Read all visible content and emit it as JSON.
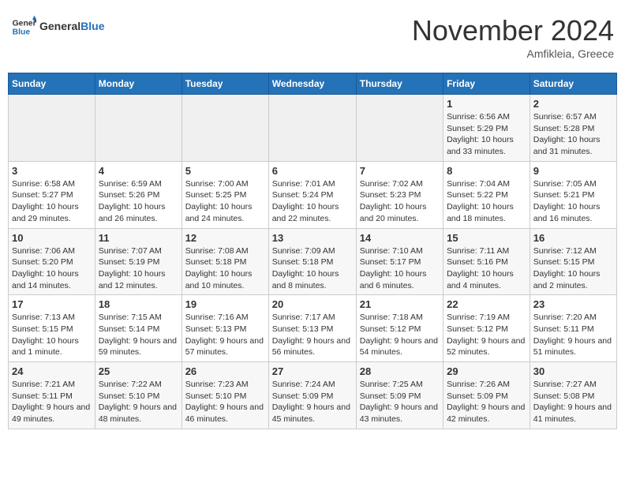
{
  "header": {
    "logo_general": "General",
    "logo_blue": "Blue",
    "month_title": "November 2024",
    "location": "Amfikleia, Greece"
  },
  "weekdays": [
    "Sunday",
    "Monday",
    "Tuesday",
    "Wednesday",
    "Thursday",
    "Friday",
    "Saturday"
  ],
  "weeks": [
    [
      {
        "day": "",
        "info": ""
      },
      {
        "day": "",
        "info": ""
      },
      {
        "day": "",
        "info": ""
      },
      {
        "day": "",
        "info": ""
      },
      {
        "day": "",
        "info": ""
      },
      {
        "day": "1",
        "info": "Sunrise: 6:56 AM\nSunset: 5:29 PM\nDaylight: 10 hours and 33 minutes."
      },
      {
        "day": "2",
        "info": "Sunrise: 6:57 AM\nSunset: 5:28 PM\nDaylight: 10 hours and 31 minutes."
      }
    ],
    [
      {
        "day": "3",
        "info": "Sunrise: 6:58 AM\nSunset: 5:27 PM\nDaylight: 10 hours and 29 minutes."
      },
      {
        "day": "4",
        "info": "Sunrise: 6:59 AM\nSunset: 5:26 PM\nDaylight: 10 hours and 26 minutes."
      },
      {
        "day": "5",
        "info": "Sunrise: 7:00 AM\nSunset: 5:25 PM\nDaylight: 10 hours and 24 minutes."
      },
      {
        "day": "6",
        "info": "Sunrise: 7:01 AM\nSunset: 5:24 PM\nDaylight: 10 hours and 22 minutes."
      },
      {
        "day": "7",
        "info": "Sunrise: 7:02 AM\nSunset: 5:23 PM\nDaylight: 10 hours and 20 minutes."
      },
      {
        "day": "8",
        "info": "Sunrise: 7:04 AM\nSunset: 5:22 PM\nDaylight: 10 hours and 18 minutes."
      },
      {
        "day": "9",
        "info": "Sunrise: 7:05 AM\nSunset: 5:21 PM\nDaylight: 10 hours and 16 minutes."
      }
    ],
    [
      {
        "day": "10",
        "info": "Sunrise: 7:06 AM\nSunset: 5:20 PM\nDaylight: 10 hours and 14 minutes."
      },
      {
        "day": "11",
        "info": "Sunrise: 7:07 AM\nSunset: 5:19 PM\nDaylight: 10 hours and 12 minutes."
      },
      {
        "day": "12",
        "info": "Sunrise: 7:08 AM\nSunset: 5:18 PM\nDaylight: 10 hours and 10 minutes."
      },
      {
        "day": "13",
        "info": "Sunrise: 7:09 AM\nSunset: 5:18 PM\nDaylight: 10 hours and 8 minutes."
      },
      {
        "day": "14",
        "info": "Sunrise: 7:10 AM\nSunset: 5:17 PM\nDaylight: 10 hours and 6 minutes."
      },
      {
        "day": "15",
        "info": "Sunrise: 7:11 AM\nSunset: 5:16 PM\nDaylight: 10 hours and 4 minutes."
      },
      {
        "day": "16",
        "info": "Sunrise: 7:12 AM\nSunset: 5:15 PM\nDaylight: 10 hours and 2 minutes."
      }
    ],
    [
      {
        "day": "17",
        "info": "Sunrise: 7:13 AM\nSunset: 5:15 PM\nDaylight: 10 hours and 1 minute."
      },
      {
        "day": "18",
        "info": "Sunrise: 7:15 AM\nSunset: 5:14 PM\nDaylight: 9 hours and 59 minutes."
      },
      {
        "day": "19",
        "info": "Sunrise: 7:16 AM\nSunset: 5:13 PM\nDaylight: 9 hours and 57 minutes."
      },
      {
        "day": "20",
        "info": "Sunrise: 7:17 AM\nSunset: 5:13 PM\nDaylight: 9 hours and 56 minutes."
      },
      {
        "day": "21",
        "info": "Sunrise: 7:18 AM\nSunset: 5:12 PM\nDaylight: 9 hours and 54 minutes."
      },
      {
        "day": "22",
        "info": "Sunrise: 7:19 AM\nSunset: 5:12 PM\nDaylight: 9 hours and 52 minutes."
      },
      {
        "day": "23",
        "info": "Sunrise: 7:20 AM\nSunset: 5:11 PM\nDaylight: 9 hours and 51 minutes."
      }
    ],
    [
      {
        "day": "24",
        "info": "Sunrise: 7:21 AM\nSunset: 5:11 PM\nDaylight: 9 hours and 49 minutes."
      },
      {
        "day": "25",
        "info": "Sunrise: 7:22 AM\nSunset: 5:10 PM\nDaylight: 9 hours and 48 minutes."
      },
      {
        "day": "26",
        "info": "Sunrise: 7:23 AM\nSunset: 5:10 PM\nDaylight: 9 hours and 46 minutes."
      },
      {
        "day": "27",
        "info": "Sunrise: 7:24 AM\nSunset: 5:09 PM\nDaylight: 9 hours and 45 minutes."
      },
      {
        "day": "28",
        "info": "Sunrise: 7:25 AM\nSunset: 5:09 PM\nDaylight: 9 hours and 43 minutes."
      },
      {
        "day": "29",
        "info": "Sunrise: 7:26 AM\nSunset: 5:09 PM\nDaylight: 9 hours and 42 minutes."
      },
      {
        "day": "30",
        "info": "Sunrise: 7:27 AM\nSunset: 5:08 PM\nDaylight: 9 hours and 41 minutes."
      }
    ]
  ]
}
